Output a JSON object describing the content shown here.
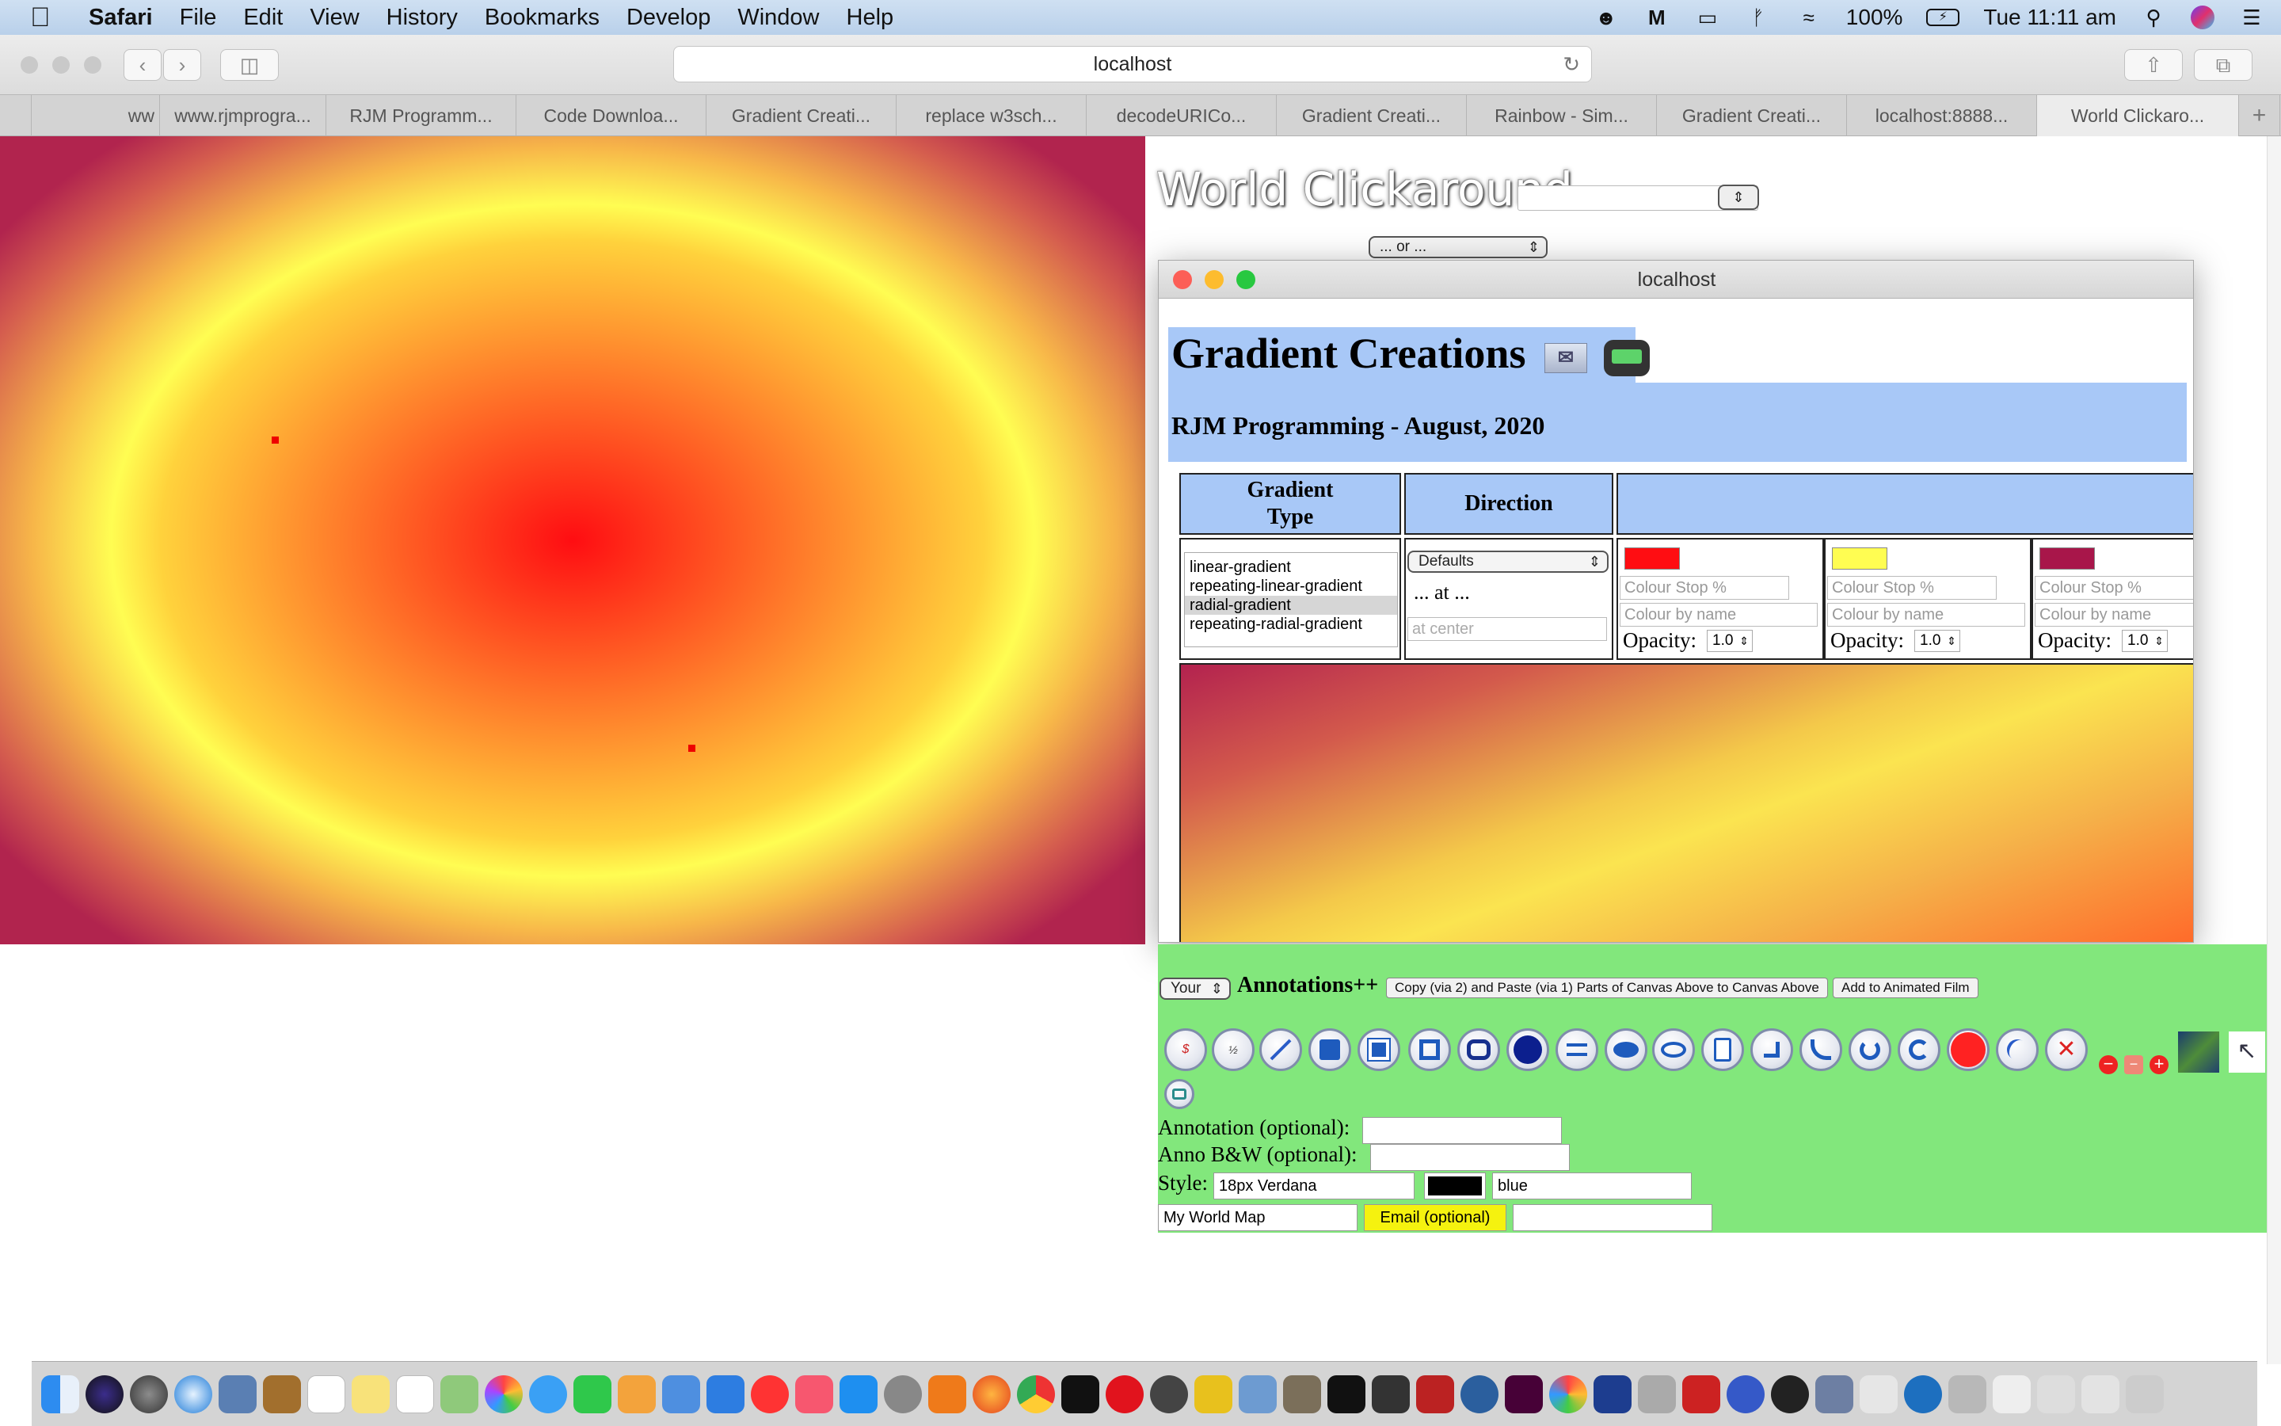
{
  "menubar": {
    "app": "Safari",
    "items": [
      "File",
      "Edit",
      "View",
      "History",
      "Bookmarks",
      "Develop",
      "Window",
      "Help"
    ],
    "battery": "100%",
    "clock": "Tue 11:11 am"
  },
  "toolbar": {
    "url": "localhost"
  },
  "tabs": [
    {
      "label": "ww"
    },
    {
      "label": "www.rjmprogra..."
    },
    {
      "label": "RJM Programm..."
    },
    {
      "label": "Code Downloa..."
    },
    {
      "label": "Gradient Creati..."
    },
    {
      "label": "replace w3sch..."
    },
    {
      "label": "decodeURICo..."
    },
    {
      "label": "Gradient Creati..."
    },
    {
      "label": "Rainbow - Sim..."
    },
    {
      "label": "Gradient Creati..."
    },
    {
      "label": "localhost:8888..."
    },
    {
      "label": "World Clickaro..."
    }
  ],
  "colors": {
    "accent_blue": "#a8c8f7",
    "panel_green": "#82e77c",
    "stop1": "#ff0d12",
    "stop2": "#fffd52",
    "stop3": "#a8164a",
    "email_button": "#f5f20f"
  },
  "page": {
    "title": "World Clickaround",
    "or_select": "... or ..."
  },
  "popup": {
    "host": "localhost",
    "title": "Gradient Creations",
    "subtitle": "RJM Programming - August, 2020",
    "col_type": "Gradient Type",
    "col_direction": "Direction",
    "gradient_types": [
      "linear-gradient",
      "repeating-linear-gradient",
      "radial-gradient",
      "repeating-radial-gradient"
    ],
    "selected_type": "radial-gradient",
    "direction_select": "Defaults",
    "at_label": "... at ...",
    "at_placeholder": "at center",
    "stops": [
      {
        "stop_placeholder": "Colour Stop %",
        "name_placeholder": "Colour by name",
        "opacity_label": "Opacity:",
        "opacity": "1.0"
      },
      {
        "stop_placeholder": "Colour Stop %",
        "name_placeholder": "Colour by name",
        "opacity_label": "Opacity:",
        "opacity": "1.0"
      },
      {
        "stop_placeholder": "Colour Stop %",
        "name_placeholder": "Colour by name",
        "opacity_label": "Opacity:",
        "opacity": "1.0"
      }
    ]
  },
  "annotations": {
    "your_select": "Your",
    "heading": "Annotations++",
    "copy_button": "Copy (via 2) and Paste (via 1) Parts of Canvas Above to Canvas Above",
    "film_button": "Add to Animated Film",
    "annotation_label": "Annotation (optional):",
    "anno_bw_label": "Anno B&W (optional):",
    "style_label": "Style:",
    "style_font": "18px Verdana",
    "style_colour": "blue",
    "map_name": "My World Map",
    "email_button": "Email (optional)"
  }
}
